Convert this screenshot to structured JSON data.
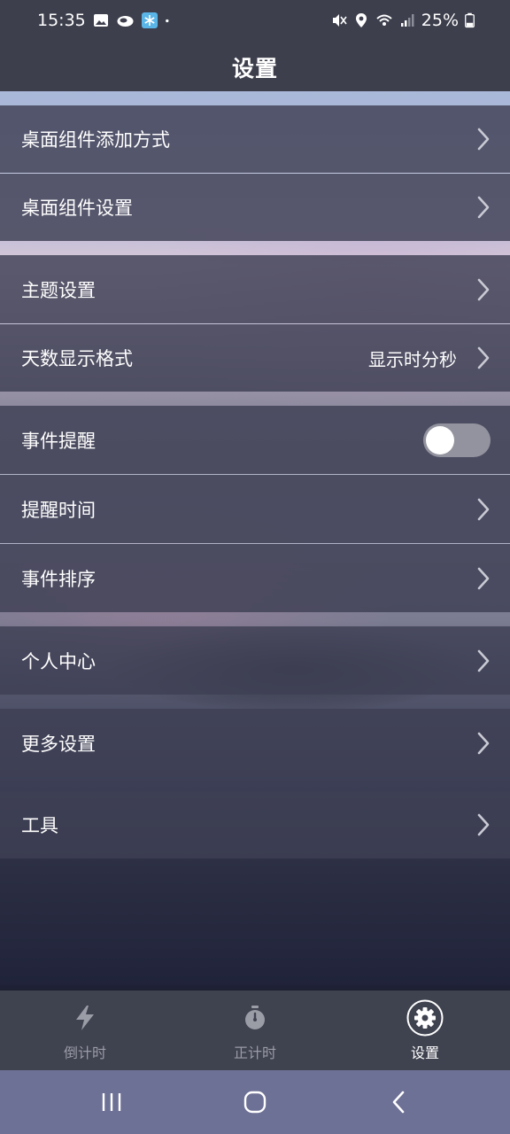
{
  "status_bar": {
    "time": "15:35",
    "battery": "25%",
    "icons_left": [
      "image-icon",
      "cloud-icon",
      "snowflake-app-icon",
      "dot-icon"
    ],
    "icons_right": [
      "mute-icon",
      "location-icon",
      "wifi-icon",
      "signal-icon",
      "battery-icon"
    ]
  },
  "header": {
    "title": "设置"
  },
  "settings": {
    "widget_add_method": "桌面组件添加方式",
    "widget_settings": "桌面组件设置",
    "theme_settings": "主题设置",
    "day_format": "天数显示格式",
    "day_format_value": "显示时分秒",
    "event_reminder": "事件提醒",
    "event_reminder_enabled": false,
    "reminder_time": "提醒时间",
    "event_sort": "事件排序",
    "personal_center": "个人中心",
    "more_settings": "更多设置",
    "tools": "工具"
  },
  "tabs": [
    {
      "label": "倒计时",
      "icon": "lightning-icon",
      "active": false
    },
    {
      "label": "正计时",
      "icon": "stopwatch-icon",
      "active": false
    },
    {
      "label": "设置",
      "icon": "gear-icon",
      "active": true
    }
  ],
  "nav_bar": {
    "buttons": [
      "recent-apps-icon",
      "home-icon",
      "back-icon"
    ]
  },
  "colors": {
    "bar_background": "#3d3f4d",
    "row_background": "#3e4054",
    "nav_background": "#6e7196",
    "toggle_off": "#a0a0aa"
  }
}
